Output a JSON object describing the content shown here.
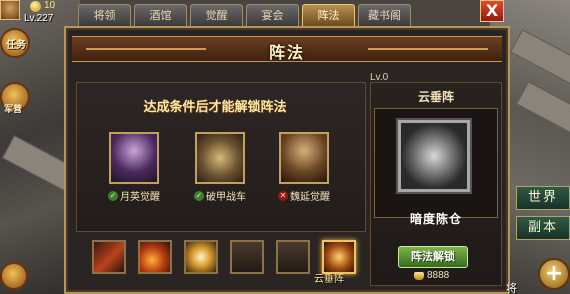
{
  "player": {
    "gold": "10",
    "level": "Lv.227"
  },
  "side_buttons": {
    "tasks": "任务",
    "camp": "军营"
  },
  "tabs": [
    {
      "label": "将领",
      "active": false
    },
    {
      "label": "酒馆",
      "active": false
    },
    {
      "label": "觉醒",
      "active": false
    },
    {
      "label": "宴会",
      "active": false
    },
    {
      "label": "阵法",
      "active": true
    },
    {
      "label": "藏书阁",
      "active": false
    }
  ],
  "close_label": "X",
  "window": {
    "title": "阵法",
    "level_requirement": "Lv.0",
    "unlock_hint": "达成条件后才能解锁阵法"
  },
  "conditions": [
    {
      "label": "月英觉醒",
      "status": "done"
    },
    {
      "label": "破甲战车",
      "status": "done"
    },
    {
      "label": "魏延觉醒",
      "status": "missing"
    }
  ],
  "skills": {
    "caption": "云垂阵",
    "items": [
      "skill-1",
      "skill-2",
      "skill-3",
      "skill-4",
      "skill-5",
      "skill-6"
    ]
  },
  "formation": {
    "name": "云垂阵",
    "subtitle": "暗度陈仓",
    "unlock_button": "阵法解锁",
    "cost": "8888"
  },
  "world_buttons": {
    "world": "世界",
    "instance": "副本"
  },
  "bottom_right_text": "将",
  "colors": {
    "accent_gold": "#c9a05a",
    "tab_active": "#b8924e",
    "unlock_green": "#5a9a35",
    "close_red": "#c7351c"
  }
}
